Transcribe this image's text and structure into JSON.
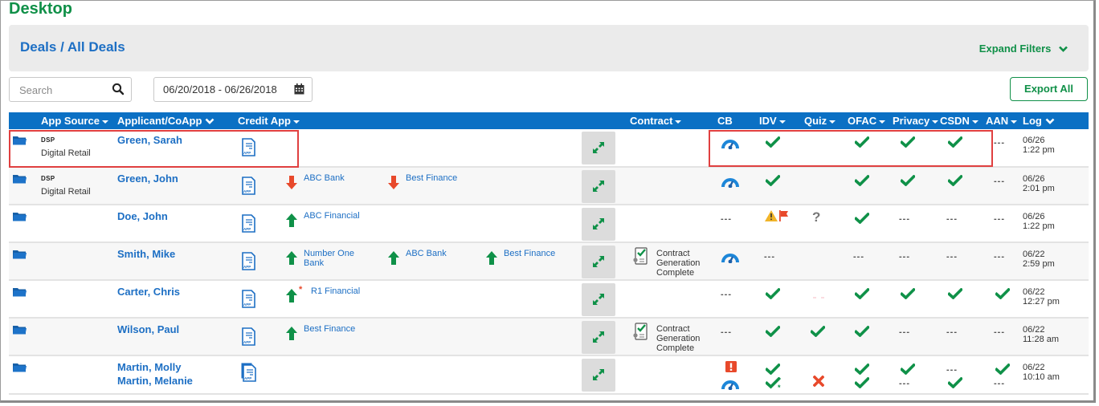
{
  "page": {
    "title": "Desktop",
    "breadcrumb": "Deals / All Deals",
    "expand_filters_label": "Expand Filters",
    "search_placeholder": "Search",
    "search_value": "",
    "date_range": "06/20/2018 - 06/26/2018",
    "export_label": "Export All"
  },
  "colors": {
    "brand_green": "#109048",
    "link_blue": "#1d6fc4",
    "header_blue": "#0b70c4",
    "error_red": "#e8492b",
    "warning_yellow": "#f0b429",
    "highlight_red": "#e04040"
  },
  "columns": [
    {
      "key": "app_source",
      "label": "App Source",
      "indicator": "caret"
    },
    {
      "key": "applicant",
      "label": "Applicant/CoApp",
      "indicator": "chevron"
    },
    {
      "key": "credit_app",
      "label": "Credit App",
      "indicator": "caret"
    },
    {
      "key": "contract",
      "label": "Contract",
      "indicator": "caret"
    },
    {
      "key": "cb",
      "label": "CB",
      "indicator": ""
    },
    {
      "key": "idv",
      "label": "IDV",
      "indicator": "caret"
    },
    {
      "key": "quiz",
      "label": "Quiz",
      "indicator": "caret"
    },
    {
      "key": "ofac",
      "label": "OFAC",
      "indicator": "caret"
    },
    {
      "key": "privacy",
      "label": "Privacy",
      "indicator": "caret"
    },
    {
      "key": "csdn",
      "label": "CSDN",
      "indicator": "caret"
    },
    {
      "key": "aan",
      "label": "AAN",
      "indicator": "caret"
    },
    {
      "key": "log",
      "label": "Log",
      "indicator": "chevron"
    }
  ],
  "rows": [
    {
      "source_code": "DSP",
      "source_name": "Digital Retail",
      "applicants": [
        "Green, Sarah"
      ],
      "app_icon": "single",
      "lenders": [],
      "contract": "",
      "cb": [
        "gauge"
      ],
      "idv": [
        "check"
      ],
      "quiz": [],
      "ofac": [
        "check"
      ],
      "privacy": [
        "check"
      ],
      "csdn": [
        "check"
      ],
      "aan": [
        "dash"
      ],
      "log_date": "06/26",
      "log_time": "1:22 pm"
    },
    {
      "source_code": "DSP",
      "source_name": "Digital Retail",
      "applicants": [
        "Green, John"
      ],
      "app_icon": "single",
      "lenders": [
        {
          "name": "ABC Bank",
          "status": "down"
        },
        {
          "name": "Best Finance",
          "status": "down"
        }
      ],
      "contract": "",
      "cb": [
        "gauge"
      ],
      "idv": [
        "check"
      ],
      "quiz": [],
      "ofac": [
        "check"
      ],
      "privacy": [
        "check"
      ],
      "csdn": [
        "check"
      ],
      "aan": [
        "dash"
      ],
      "log_date": "06/26",
      "log_time": "2:01 pm"
    },
    {
      "source_code": "",
      "source_name": "",
      "applicants": [
        "Doe, John"
      ],
      "app_icon": "single",
      "lenders": [
        {
          "name": "ABC Financial",
          "status": "up"
        }
      ],
      "contract": "",
      "cb": [
        "dash"
      ],
      "idv": [
        "warning-flag"
      ],
      "quiz": [
        "question"
      ],
      "ofac": [
        "check"
      ],
      "privacy": [
        "dash"
      ],
      "csdn": [
        "dash"
      ],
      "aan": [
        "dash"
      ],
      "log_date": "06/26",
      "log_time": "1:22 pm"
    },
    {
      "source_code": "",
      "source_name": "",
      "applicants": [
        "Smith, Mike"
      ],
      "app_icon": "single",
      "lenders": [
        {
          "name": "Number One Bank",
          "status": "up"
        },
        {
          "name": "ABC Bank",
          "status": "up"
        },
        {
          "name": "Best Finance",
          "status": "up"
        }
      ],
      "contract": "Contract Generation Complete",
      "cb": [
        "gauge"
      ],
      "idv": [
        "dash"
      ],
      "quiz": [],
      "ofac": [
        "dash"
      ],
      "privacy": [
        "dash"
      ],
      "csdn": [
        "dash"
      ],
      "aan": [
        "dash"
      ],
      "log_date": "06/22",
      "log_time": "2:59 pm"
    },
    {
      "source_code": "",
      "source_name": "",
      "applicants": [
        "Carter, Chris"
      ],
      "app_icon": "single",
      "lenders": [
        {
          "name": "R1 Financial",
          "status": "up",
          "asterisk": true
        }
      ],
      "contract": "",
      "cb": [
        "dash"
      ],
      "idv": [
        "check"
      ],
      "quiz": [
        "faint"
      ],
      "ofac": [
        "check"
      ],
      "privacy": [
        "check"
      ],
      "csdn": [
        "check"
      ],
      "aan": [
        "check"
      ],
      "log_date": "06/22",
      "log_time": "12:27 pm"
    },
    {
      "source_code": "",
      "source_name": "",
      "applicants": [
        "Wilson, Paul"
      ],
      "app_icon": "single",
      "lenders": [
        {
          "name": "Best Finance",
          "status": "up"
        }
      ],
      "contract": "Contract Generation Complete",
      "cb": [
        "dash"
      ],
      "idv": [
        "check"
      ],
      "quiz": [
        "check"
      ],
      "ofac": [
        "check"
      ],
      "privacy": [
        "dash"
      ],
      "csdn": [
        "dash"
      ],
      "aan": [
        "dash"
      ],
      "log_date": "06/22",
      "log_time": "11:28 am"
    },
    {
      "source_code": "",
      "source_name": "",
      "applicants": [
        "Martin, Molly",
        "Martin, Melanie"
      ],
      "app_icon": "double",
      "lenders": [],
      "contract": "",
      "cb": [
        "alert",
        "gauge"
      ],
      "idv": [
        "check",
        "check-star"
      ],
      "quiz": [
        "x"
      ],
      "ofac": [
        "check",
        "check"
      ],
      "privacy": [
        "check",
        "dash"
      ],
      "csdn": [
        "dash",
        "check"
      ],
      "aan": [
        "check",
        "dash"
      ],
      "log_date": "06/22",
      "log_time": "10:10 am"
    }
  ]
}
